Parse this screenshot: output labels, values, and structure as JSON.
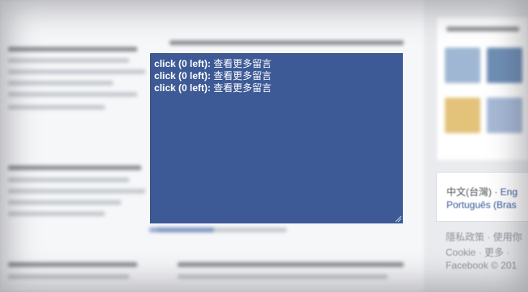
{
  "overlay": {
    "lines": [
      {
        "prefix": "click (0 left):",
        "text": "查看更多留言"
      },
      {
        "prefix": "click (0 left):",
        "text": "查看更多留言"
      },
      {
        "prefix": "click (0 left):",
        "text": "查看更多留言"
      }
    ],
    "background_color": "#3d5a96"
  },
  "language_box": {
    "line1_current": "中文(台灣)",
    "line1_sep": " · ",
    "line1_link": "Eng",
    "line2_link": "Português (Bras"
  },
  "footer": {
    "line1": "隱私政策 · 使用你",
    "line2": "Cookie · 更多 ·",
    "line3": "Facebook © 201"
  },
  "colors": {
    "page_bg": "#e9ebee",
    "link": "#365899",
    "muted": "#90949c"
  }
}
